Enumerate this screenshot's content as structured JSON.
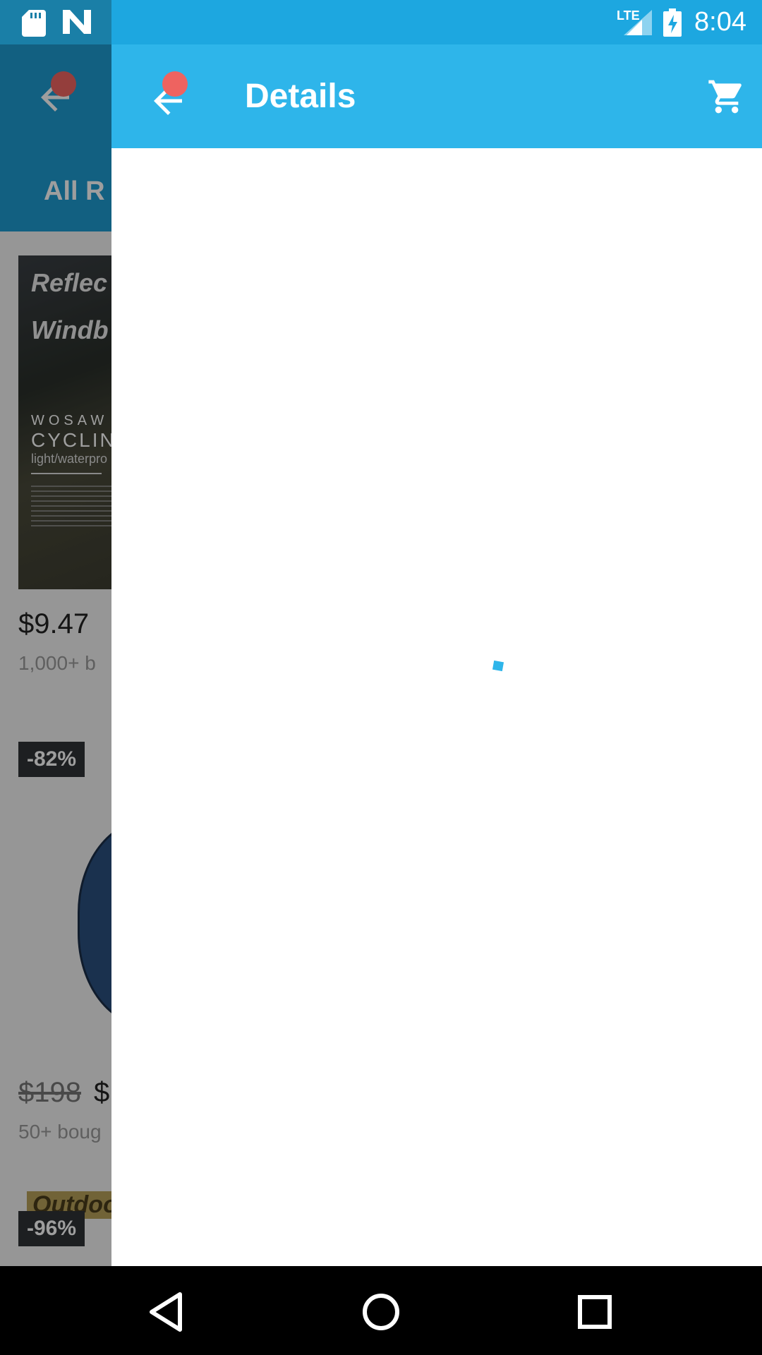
{
  "status_bar": {
    "time": "8:04",
    "network": "LTE",
    "icons": [
      "sd-card-icon",
      "n-logo-icon",
      "signal-icon",
      "battery-charging-icon"
    ]
  },
  "background_screen": {
    "tab_label": "All R",
    "product_1": {
      "image_title_line1": "Reflec",
      "image_title_line2": "Windb",
      "image_brand": "WOSAW",
      "image_subtitle": "CYCLIN",
      "image_caption": "light/waterpro",
      "price": "$9.47",
      "bought": "1,000+ b"
    },
    "product_2": {
      "discount": "-82%",
      "old_price": "$198",
      "new_price": "$",
      "bought": "50+ boug"
    },
    "product_3": {
      "banner": "Outdoo",
      "discount": "-96%"
    }
  },
  "details": {
    "title": "Details",
    "back_icon": "back-arrow-icon",
    "cart_icon": "cart-icon",
    "accent_color": "#2eb5ea",
    "notification_dot_color": "#ee6360"
  },
  "nav_bar": {
    "buttons": [
      "back-triangle-icon",
      "home-circle-icon",
      "recents-square-icon"
    ]
  }
}
